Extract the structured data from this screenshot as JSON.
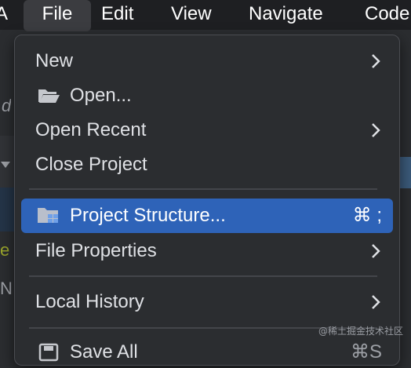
{
  "menubar": {
    "items": [
      "A",
      "File",
      "Edit",
      "View",
      "Navigate",
      "Code"
    ]
  },
  "background": {
    "fragments": [
      "d",
      "e",
      "N"
    ]
  },
  "file_menu": {
    "items": [
      {
        "label": "New",
        "submenu": true
      },
      {
        "label": "Open...",
        "icon": "folder-open-icon"
      },
      {
        "label": "Open Recent",
        "submenu": true
      },
      {
        "label": "Close Project"
      },
      {
        "label": "Project Structure...",
        "icon": "project-structure-icon",
        "shortcut": "⌘ ;",
        "selected": true
      },
      {
        "label": "File Properties",
        "submenu": true
      },
      {
        "label": "Local History",
        "submenu": true
      },
      {
        "label": "Save All",
        "shortcut": "⌘S"
      }
    ]
  },
  "watermark": "@稀土掘金技术社区",
  "colors": {
    "menubar": "#1e1f22",
    "menu_bg": "#2b2d30",
    "selection": "#2e63b8",
    "text": "#dfe1e5"
  }
}
